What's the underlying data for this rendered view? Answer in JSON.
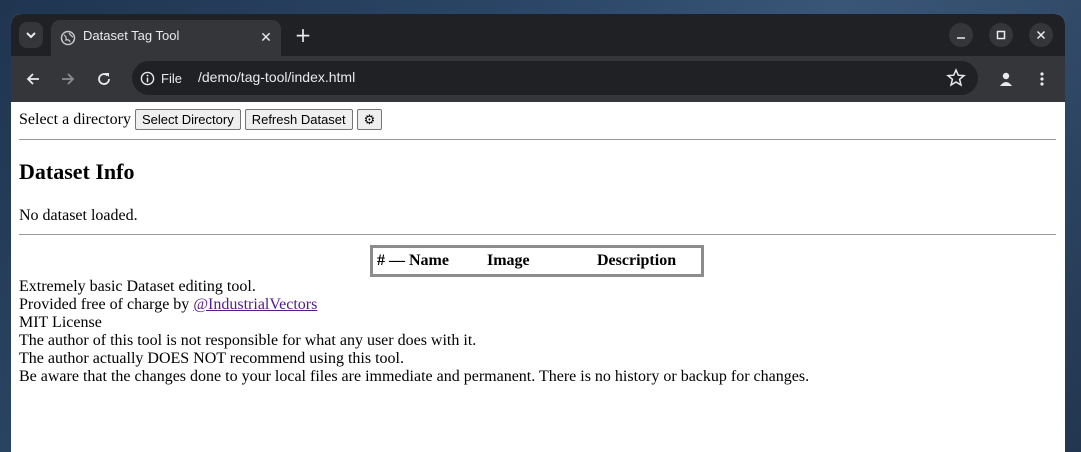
{
  "browser": {
    "tab_title": "Dataset Tag Tool",
    "site_label": "File",
    "url": "/demo/tag-tool/index.html"
  },
  "page": {
    "select_label": "Select a directory",
    "select_button": "Select Directory",
    "refresh_button": "Refresh Dataset",
    "settings_button": "⚙",
    "heading": "Dataset Info",
    "status": "No dataset loaded.",
    "table_headers": [
      "# — Name",
      "Image",
      "Description"
    ],
    "info_lines": {
      "line1": "Extremely basic Dataset editing tool.",
      "line2_prefix": "Provided free of charge by ",
      "line2_link": "@IndustrialVectors",
      "line3": "MIT License",
      "line4": "The author of this tool is not responsible for what any user does with it.",
      "line5": "The author actually DOES NOT recommend using this tool.",
      "line6": "Be aware that the changes done to your local files are immediate and permanent. There is no history or backup for changes."
    }
  }
}
